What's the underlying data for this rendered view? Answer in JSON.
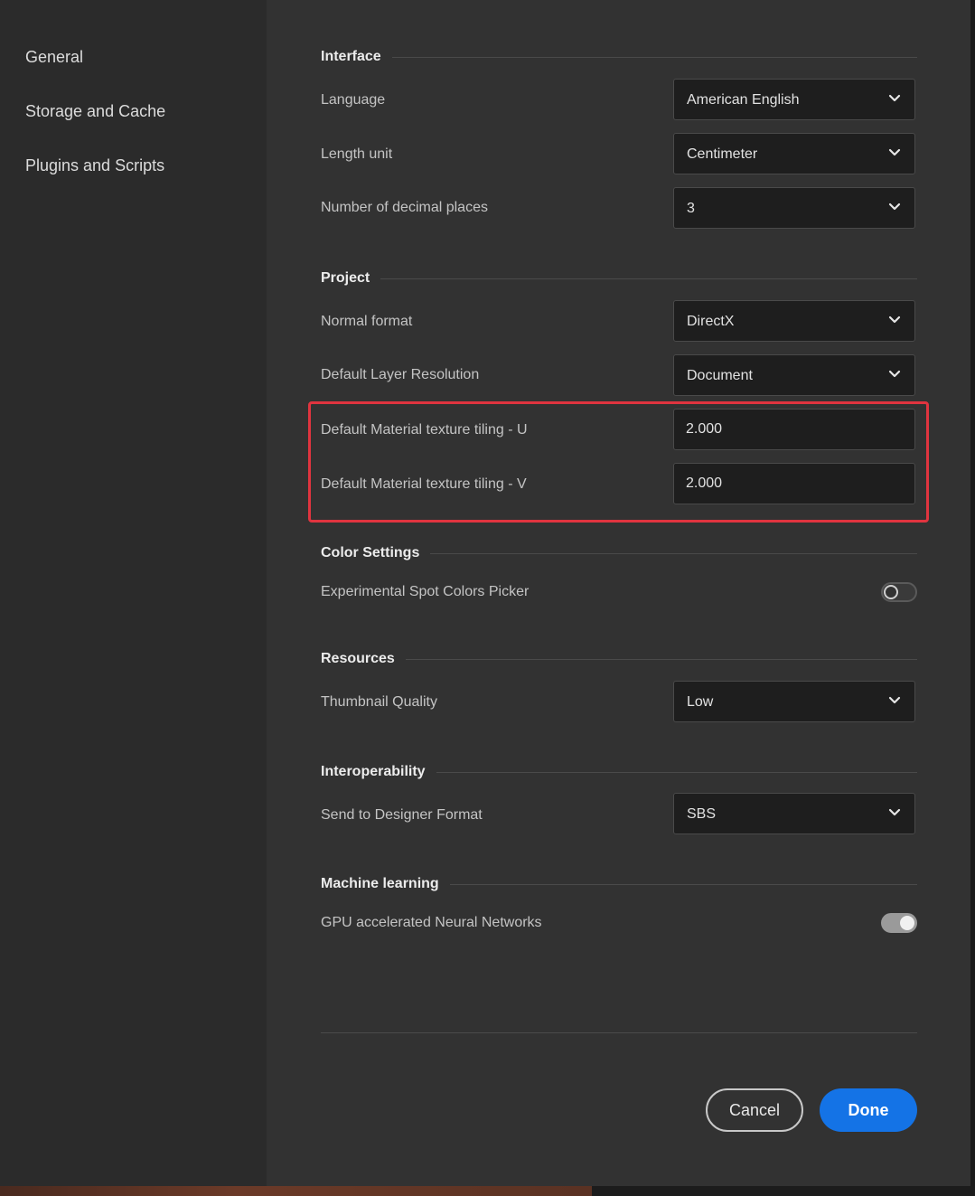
{
  "sidebar": {
    "items": [
      {
        "label": "General"
      },
      {
        "label": "Storage and Cache"
      },
      {
        "label": "Plugins and Scripts"
      }
    ]
  },
  "sections": {
    "interface": {
      "title": "Interface",
      "language": {
        "label": "Language",
        "value": "American English"
      },
      "length_unit": {
        "label": "Length unit",
        "value": "Centimeter"
      },
      "decimal_places": {
        "label": "Number of decimal places",
        "value": "3"
      }
    },
    "project": {
      "title": "Project",
      "normal_format": {
        "label": "Normal format",
        "value": "DirectX"
      },
      "layer_resolution": {
        "label": "Default Layer Resolution",
        "value": "Document"
      },
      "tiling_u": {
        "label": "Default Material texture tiling - U",
        "value": "2.000"
      },
      "tiling_v": {
        "label": "Default Material texture tiling - V",
        "value": "2.000"
      }
    },
    "color_settings": {
      "title": "Color Settings",
      "spot_colors": {
        "label": "Experimental Spot Colors Picker",
        "enabled": false
      }
    },
    "resources": {
      "title": "Resources",
      "thumbnail_quality": {
        "label": "Thumbnail Quality",
        "value": "Low"
      }
    },
    "interoperability": {
      "title": "Interoperability",
      "designer_format": {
        "label": "Send to Designer Format",
        "value": "SBS"
      }
    },
    "machine_learning": {
      "title": "Machine learning",
      "gpu_neural": {
        "label": "GPU accelerated Neural Networks",
        "enabled": true
      }
    }
  },
  "footer": {
    "cancel_label": "Cancel",
    "done_label": "Done"
  },
  "colors": {
    "accent": "#1473e6",
    "highlight": "#e0343f",
    "background": "#323232",
    "sidebar_background": "#2b2b2b"
  },
  "icons": {
    "dropdown": "chevron-down-icon"
  }
}
